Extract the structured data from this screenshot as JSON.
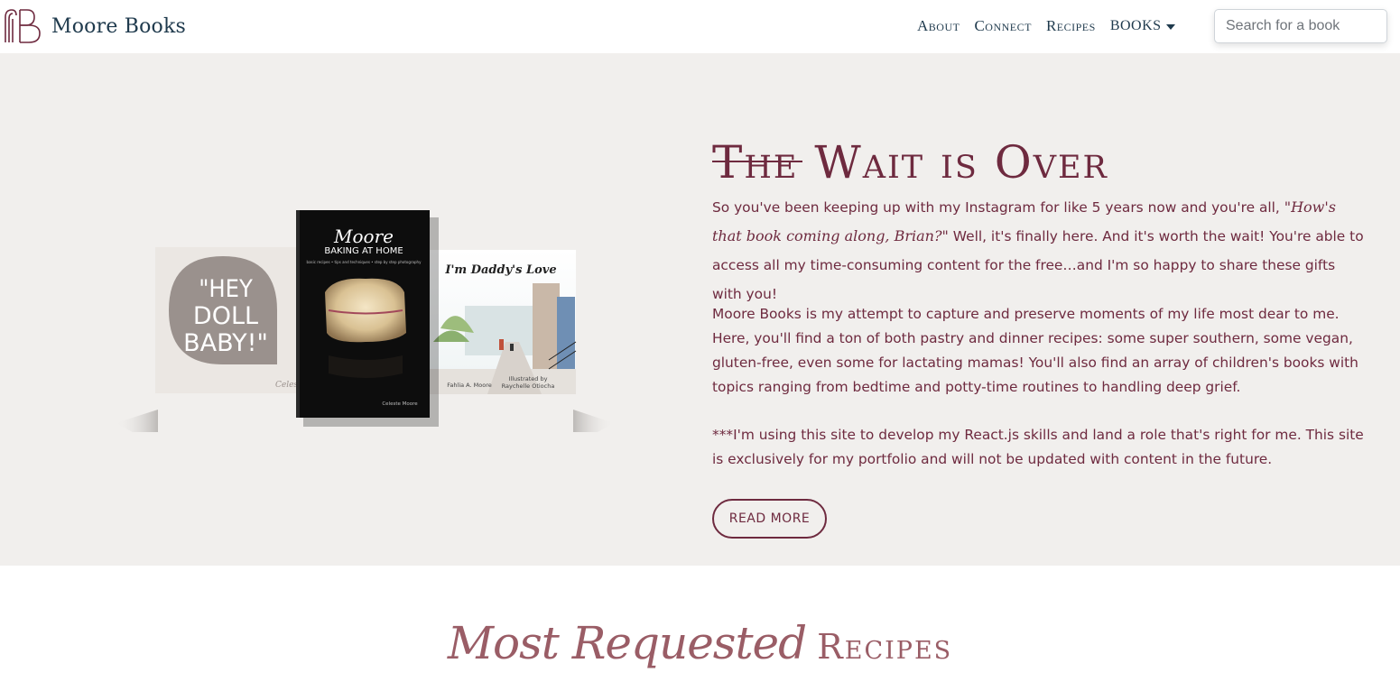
{
  "nav": {
    "brand": "Moore Books",
    "links": [
      "About",
      "Connect",
      "Recipes"
    ],
    "books_label": "BOOKS",
    "search_placeholder": "Search for a book"
  },
  "hero": {
    "title": "The Wait is Over",
    "p1_a": "So you've been keeping up with my Instagram for like 5 years now and you're all, ",
    "p1_quote": "\"How's that book coming along, Brian?\"",
    "p1_b": " Well, it's finally here. And it's worth the wait! You're able to access all my time-consuming content for the free…and I'm so happy to share these gifts with you!",
    "p2": "Moore Books is my attempt to capture and preserve moments of my life most dear to me. Here, you'll find a ton of both pastry and dinner recipes: some super southern, some vegan, gluten-free, even some for lactating mamas! You'll also find an array of children's books with topics ranging from bedtime and potty-time routines to handling deep grief.",
    "p3": "***I'm using this site to develop my React.js skills and land a role that's right for me. This site is exclusively for my portfolio and will not be updated with content in the future.",
    "button": "READ MORE"
  },
  "books": {
    "left_cover": [
      "\"HEY",
      "DOLL",
      "BABY!\""
    ],
    "left_signature": "Celeste",
    "center_script": "Moore",
    "center_title": "BAKING AT HOME",
    "center_sub": "basic recipes • tips and techniques • step by step photography",
    "center_author": "Celeste Moore",
    "right_title": "I'm Daddy's Love",
    "right_author": "Fahlia A. Moore",
    "right_illus_1": "Illustrated by",
    "right_illus_2": "Raychelle Otiocha"
  },
  "section": {
    "script": "Most Requested",
    "caps": "Recipes"
  },
  "colors": {
    "accent": "#6e2a3f",
    "nav_text": "#1f3a4d",
    "hero_bg": "#f1efed",
    "section_title": "#9a5d66"
  }
}
